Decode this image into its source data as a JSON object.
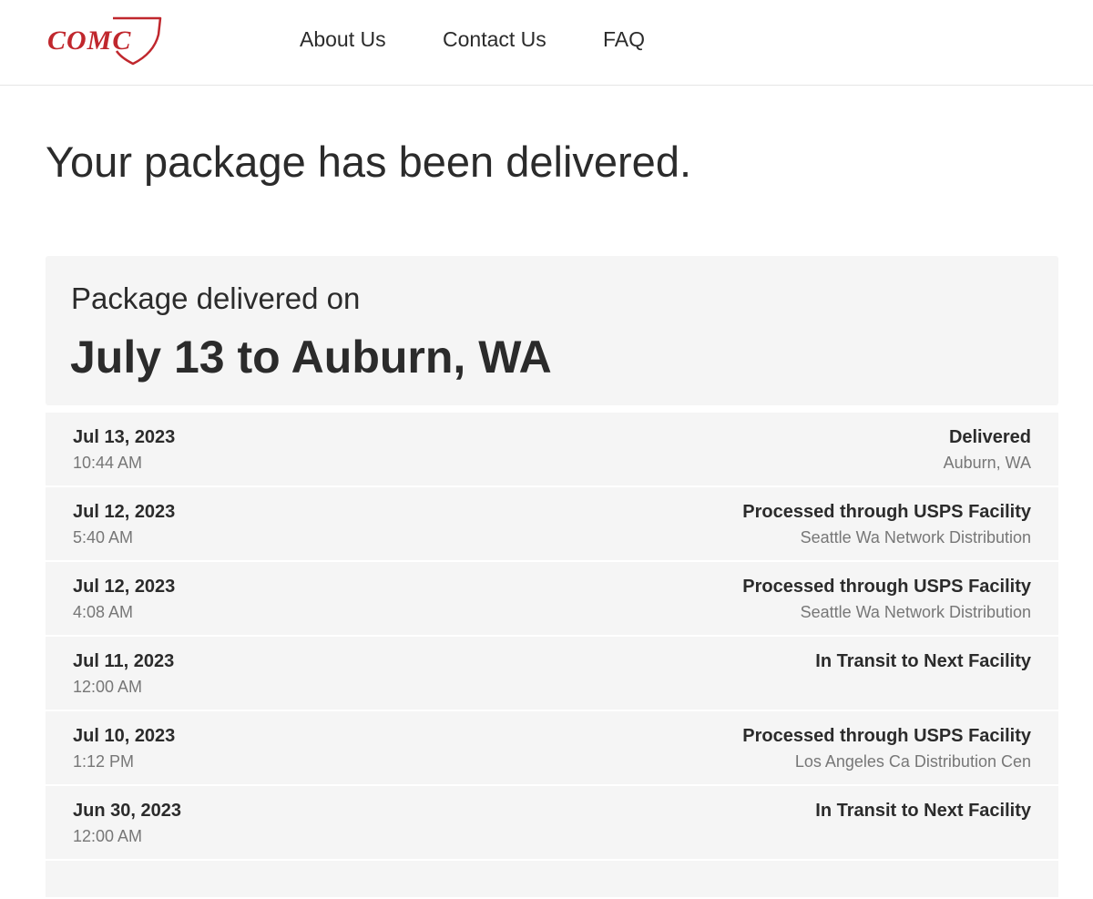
{
  "header": {
    "logo_text": "COMC",
    "nav": [
      {
        "label": "About Us"
      },
      {
        "label": "Contact Us"
      },
      {
        "label": "FAQ"
      }
    ]
  },
  "page_title": "Your package has been delivered.",
  "summary": {
    "label": "Package delivered on",
    "value": "July 13 to Auburn, WA"
  },
  "events": [
    {
      "date": "Jul 13, 2023",
      "time": "10:44 AM",
      "status": "Delivered",
      "location": "Auburn, WA"
    },
    {
      "date": "Jul 12, 2023",
      "time": "5:40 AM",
      "status": "Processed through USPS Facility",
      "location": "Seattle Wa Network Distribution"
    },
    {
      "date": "Jul 12, 2023",
      "time": "4:08 AM",
      "status": "Processed through USPS Facility",
      "location": "Seattle Wa Network Distribution"
    },
    {
      "date": "Jul 11, 2023",
      "time": "12:00 AM",
      "status": "In Transit to Next Facility",
      "location": ""
    },
    {
      "date": "Jul 10, 2023",
      "time": "1:12 PM",
      "status": "Processed through USPS Facility",
      "location": "Los Angeles Ca Distribution Cen"
    },
    {
      "date": "Jun 30, 2023",
      "time": "12:00 AM",
      "status": "In Transit to Next Facility",
      "location": ""
    }
  ],
  "colors": {
    "brand": "#c0272d",
    "text": "#2b2b2b",
    "muted": "#777777",
    "panel": "#f5f5f5"
  }
}
